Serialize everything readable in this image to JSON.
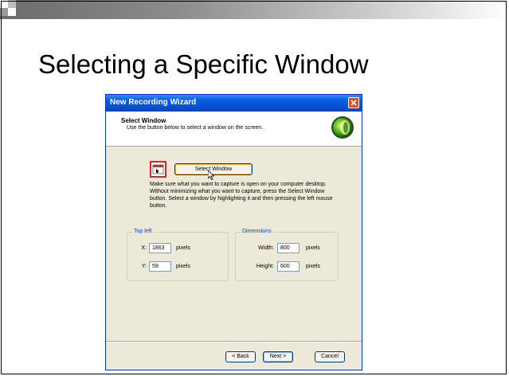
{
  "slide": {
    "title": "Selecting a Specific Window"
  },
  "dialog": {
    "title": "New Recording Wizard",
    "header_title": "Select Window",
    "header_subtitle": "Use the button below to select a window on the screen.",
    "select_window_button": "Select Window",
    "instructions": "Make sure what you want to capture is open on your computer desktop. Without minimizing what you want to capture, press the Select Window button.  Select a window by highlighting it and then pressing the left mouse button.",
    "top_left": {
      "legend": "Top left",
      "x_label": "X:",
      "x_value": "1863",
      "y_label": "Y:",
      "y_value": "59",
      "unit": "pixels"
    },
    "dimensions": {
      "legend": "Dimensions",
      "width_label": "Width:",
      "width_value": "800",
      "height_label": "Height:",
      "height_value": "600",
      "unit": "pixels"
    },
    "buttons": {
      "back": "< Back",
      "next": "Next >",
      "cancel": "Cancel"
    }
  },
  "colors": {
    "titlebar": "#0a5fe3",
    "dialog_bg": "#ece9d8",
    "legend_text": "#0046d5",
    "close_button": "#e24b25"
  },
  "icons": [
    "close-icon",
    "logo-icon",
    "select-window-icon",
    "cursor-icon"
  ]
}
